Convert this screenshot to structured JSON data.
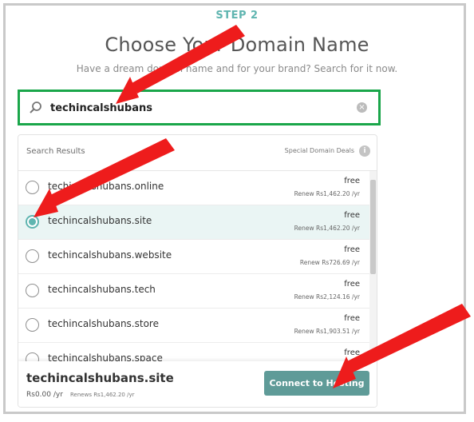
{
  "step_label": "STEP 2",
  "heading": "Choose Your Domain Name",
  "subheading": "Have a dream domain name and for your brand? Search for it now.",
  "search": {
    "value": "techincalshubans",
    "icon": "search-icon",
    "clear_icon": "clear-icon"
  },
  "results": {
    "title": "Search Results",
    "deals_label": "Special Domain Deals",
    "info_icon": "i",
    "rows": [
      {
        "name": "techincalshubans.online",
        "price": "free",
        "renew": "Renew Rs1,462.20 /yr",
        "selected": false
      },
      {
        "name": "techincalshubans.site",
        "price": "free",
        "renew": "Renew Rs1,462.20 /yr",
        "selected": true
      },
      {
        "name": "techincalshubans.website",
        "price": "free",
        "renew": "Renew Rs726.69 /yr",
        "selected": false
      },
      {
        "name": "techincalshubans.tech",
        "price": "free",
        "renew": "Renew Rs2,124.16 /yr",
        "selected": false
      },
      {
        "name": "techincalshubans.store",
        "price": "free",
        "renew": "Renew Rs1,903.51 /yr",
        "selected": false
      },
      {
        "name": "techincalshubans.space",
        "price": "free",
        "renew": "",
        "selected": false
      }
    ]
  },
  "footer": {
    "selected_domain": "techincalshubans.site",
    "price": "Rs0.00 /yr",
    "renew": "Renews Rs1,462.20 /yr",
    "connect_label": "Connect to Hosting"
  },
  "colors": {
    "accent": "#5fb5b0",
    "highlight_border": "#1aa64a",
    "arrow": "#ee1c1c",
    "button": "#5f9b98"
  }
}
